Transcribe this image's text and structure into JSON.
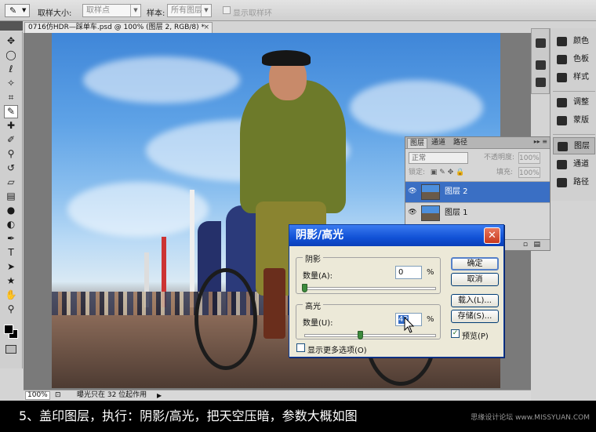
{
  "option_bar": {
    "sample_size_label": "取样大小:",
    "sample_size_value": "取样点",
    "sample_label": "样本:",
    "sample_value": "所有图层",
    "show_ring_label": "显示取样环"
  },
  "document": {
    "tab_title": "0716仿HDR—踩单车.psd @ 100% (图层 2, RGB/8) *",
    "close": "×"
  },
  "status_bar": {
    "zoom": "100%",
    "info": "曝光只在 32 位起作用"
  },
  "right_panels": {
    "items": [
      {
        "label": "颜色",
        "icon": "color-icon"
      },
      {
        "label": "色板",
        "icon": "swatches-icon"
      },
      {
        "label": "样式",
        "icon": "styles-icon"
      },
      {
        "label": "调整",
        "icon": "adjustments-icon"
      },
      {
        "label": "蒙版",
        "icon": "masks-icon"
      },
      {
        "label": "图层",
        "icon": "layers-icon"
      },
      {
        "label": "通道",
        "icon": "channels-icon"
      },
      {
        "label": "路径",
        "icon": "paths-icon"
      }
    ]
  },
  "layers_panel": {
    "tabs": [
      "图层",
      "通道",
      "路径"
    ],
    "blend_mode": "正常",
    "opacity_label": "不透明度:",
    "opacity_value": "100%",
    "lock_label": "锁定:",
    "fill_label": "填充:",
    "fill_value": "100%",
    "layers": [
      {
        "name": "图层 2",
        "selected": true
      },
      {
        "name": "图层 1",
        "selected": false
      }
    ]
  },
  "dialog": {
    "title": "阴影/高光",
    "shadows_group": "阴影",
    "shadows_amount_label": "数量(A):",
    "shadows_amount_value": "0",
    "highlights_group": "高光",
    "highlights_amount_label": "数量(U):",
    "highlights_amount_value": "42",
    "percent": "%",
    "ok": "确定",
    "cancel": "取消",
    "load": "载入(L)...",
    "save": "存储(S)...",
    "preview_label": "预览(P)",
    "preview_checked": true,
    "more_options_label": "显示更多选项(O)",
    "more_options_checked": false,
    "shadows_slider_fraction": 0.0,
    "highlights_slider_fraction": 0.42
  },
  "caption": {
    "text": "5、盖印图层，执行：阴影/高光，把天空压暗，参数大概如图",
    "watermark": "思缘设计论坛 www.MISSYUAN.COM"
  }
}
